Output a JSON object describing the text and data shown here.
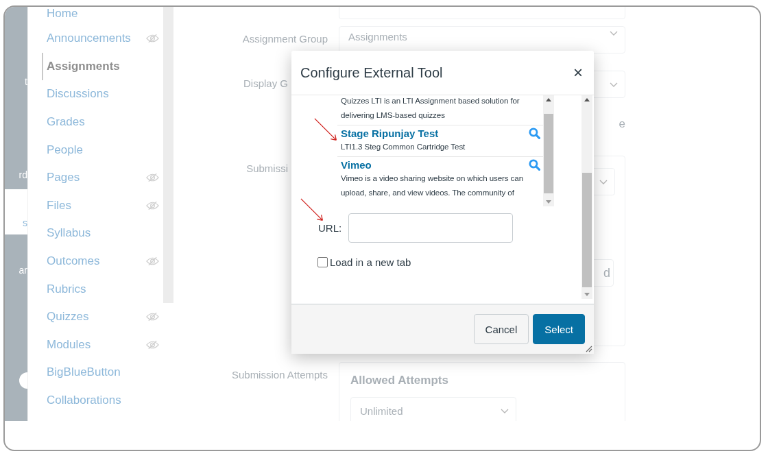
{
  "global_nav": {
    "labels": [
      {
        "text": "t",
        "kind": "dark"
      },
      {
        "text": "rd",
        "kind": "dark"
      },
      {
        "text": "s",
        "kind": "light"
      },
      {
        "text": "ar",
        "kind": "dark"
      }
    ]
  },
  "course_nav": {
    "items": [
      {
        "label": "Home",
        "selected": false,
        "hidden": false
      },
      {
        "label": "Announcements",
        "selected": false,
        "hidden": true
      },
      {
        "label": "Assignments",
        "selected": true,
        "hidden": false
      },
      {
        "label": "Discussions",
        "selected": false,
        "hidden": false
      },
      {
        "label": "Grades",
        "selected": false,
        "hidden": false
      },
      {
        "label": "People",
        "selected": false,
        "hidden": false
      },
      {
        "label": "Pages",
        "selected": false,
        "hidden": true
      },
      {
        "label": "Files",
        "selected": false,
        "hidden": true
      },
      {
        "label": "Syllabus",
        "selected": false,
        "hidden": false
      },
      {
        "label": "Outcomes",
        "selected": false,
        "hidden": true
      },
      {
        "label": "Rubrics",
        "selected": false,
        "hidden": false
      },
      {
        "label": "Quizzes",
        "selected": false,
        "hidden": true
      },
      {
        "label": "Modules",
        "selected": false,
        "hidden": true
      },
      {
        "label": "BigBlueButton",
        "selected": false,
        "hidden": false
      },
      {
        "label": "Collaborations",
        "selected": false,
        "hidden": false
      }
    ]
  },
  "form": {
    "assignment_group": {
      "label": "Assignment Group",
      "value": "Assignments"
    },
    "display_label": "Display G",
    "side_fragment": "e",
    "submission_label": "Submissi",
    "button_fragment": "d",
    "attempts": {
      "label": "Submission Attempts",
      "heading": "Allowed Attempts",
      "value": "Unlimited"
    }
  },
  "dialog": {
    "title": "Configure External Tool",
    "close": "×",
    "tools": [
      {
        "description_lines": [
          "Quizzes LTI is an LTI Assignment based solution for",
          "delivering LMS-based quizzes"
        ]
      },
      {
        "name": "Stage Ripunjay Test",
        "description_lines": [
          "LTI1.3 Steg Common Cartridge Test"
        ]
      },
      {
        "name": "Vimeo",
        "description_lines": [
          "Vimeo is a video sharing website on which users can",
          "upload, share, and view videos. The community of"
        ]
      }
    ],
    "url": {
      "label": "URL:"
    },
    "new_tab": {
      "label": "Load in a new tab",
      "checked": false
    },
    "buttons": [
      {
        "label": "Cancel",
        "kind": "secondary"
      },
      {
        "label": "Select",
        "kind": "primary"
      }
    ]
  }
}
